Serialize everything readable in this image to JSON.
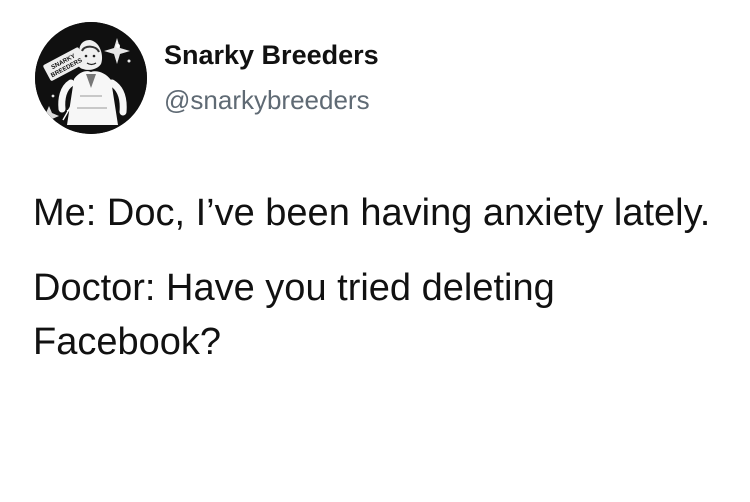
{
  "profile": {
    "display_name": "Snarky Breeders",
    "handle": "@snarkybreeders",
    "avatar_logo_text": "SNARKY BREEDERS"
  },
  "tweet": {
    "paragraphs": [
      "Me: Doc, I’ve been having anxiety lately.",
      "Doctor: Have you tried deleting Facebook?"
    ]
  },
  "colors": {
    "background": "#ffffff",
    "primary_text": "#111111",
    "secondary_text": "#5f6a74",
    "avatar_background": "#101010"
  }
}
